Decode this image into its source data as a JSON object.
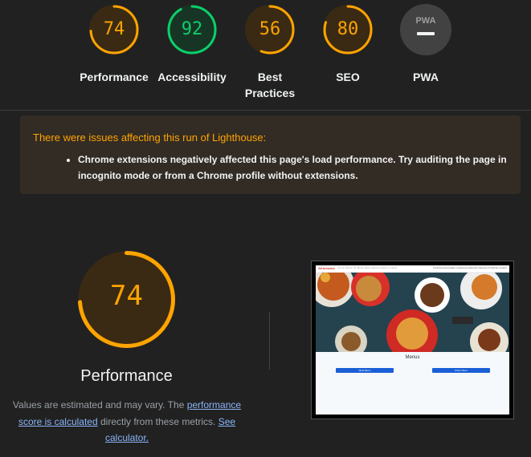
{
  "categories": [
    {
      "score": "74",
      "label": "Performance",
      "color": "#ffa400",
      "fill": 0.74,
      "icon": ""
    },
    {
      "score": "92",
      "label": "Accessibility",
      "color": "#0cce6b",
      "fill": 0.92,
      "icon": ""
    },
    {
      "score": "56",
      "label": "Best Practices",
      "color": "#ffa400",
      "fill": 0.56,
      "icon": ""
    },
    {
      "score": "80",
      "label": "SEO",
      "color": "#ffa400",
      "fill": 0.8,
      "icon": ""
    },
    {
      "score": "",
      "label": "PWA",
      "color": "#9e9e9e",
      "fill": 0,
      "icon": "pwa-badge-icon",
      "badge_text": "PWA"
    }
  ],
  "warning": {
    "title": "There were issues affecting this run of Lighthouse:",
    "items": [
      "Chrome extensions negatively affected this page's load performance. Try auditing the page in incognito mode or from a Chrome profile without extensions."
    ]
  },
  "performance": {
    "score": "74",
    "fill": 0.74,
    "title": "Performance",
    "note_prefix": "Values are estimated and may vary. The ",
    "note_link1": "performance score is calculated",
    "note_middle": " directly from these metrics. ",
    "note_link2": "See calculator."
  },
  "screenshot": {
    "logo": "Afrinmeals",
    "nav_links": "Home  About Us  Menu  Store  Reservations  Logout",
    "tagline": "Freshest and Quality, Capturing Authentic Flavours of African Cuisine",
    "menus_title": "Menus",
    "button1": "Meal Menu",
    "button2": "Order Menu"
  },
  "colors": {
    "background": "#212121",
    "average": "#ffa400",
    "pass": "#0cce6b",
    "warning_bg": "#332c24",
    "link": "#8ab4f8"
  }
}
